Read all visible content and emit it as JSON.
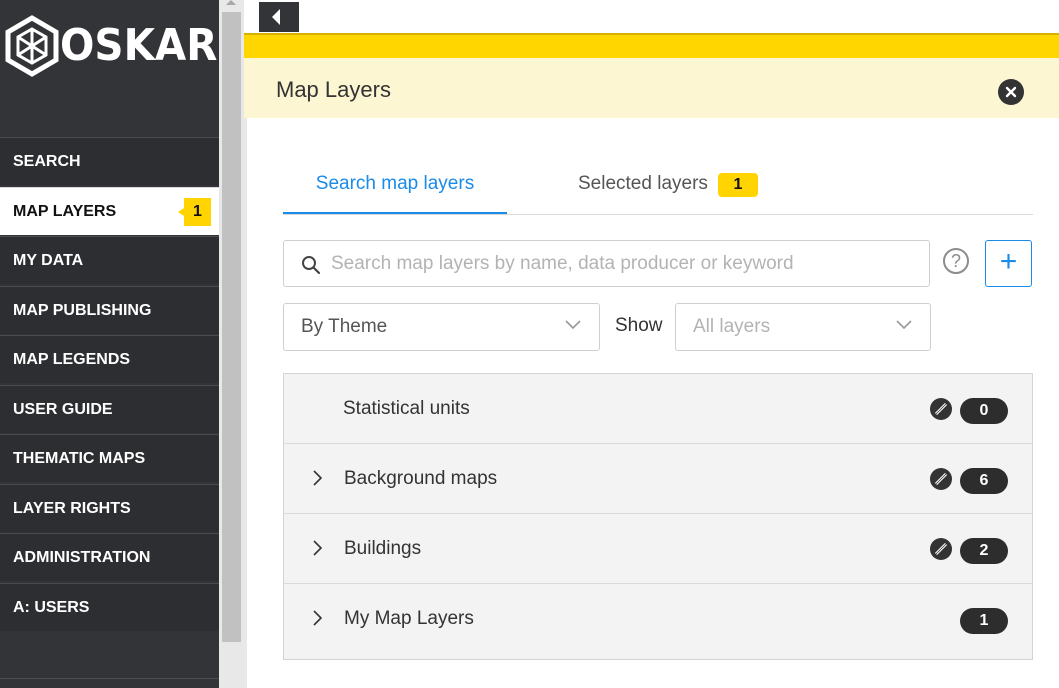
{
  "app": {
    "logo_text": "OSKARI"
  },
  "sidebar": {
    "items": [
      {
        "label": "SEARCH"
      },
      {
        "label": "MAP LAYERS",
        "badge": "1",
        "active": true
      },
      {
        "label": "MY DATA"
      },
      {
        "label": "MAP PUBLISHING"
      },
      {
        "label": "MAP LEGENDS"
      },
      {
        "label": "USER GUIDE"
      },
      {
        "label": "THEMATIC MAPS"
      },
      {
        "label": "LAYER RIGHTS"
      },
      {
        "label": "ADMINISTRATION"
      },
      {
        "label": "A: USERS"
      }
    ]
  },
  "flyout": {
    "title": "Map Layers",
    "tabs": [
      {
        "label": "Search map layers",
        "active": true
      },
      {
        "label": "Selected layers",
        "badge": "1"
      }
    ],
    "search": {
      "placeholder": "Search map layers by name, data producer or keyword",
      "value": ""
    },
    "help_label": "?",
    "add_label": "+",
    "grouping_select": {
      "value": "By Theme"
    },
    "show_label": "Show",
    "show_select": {
      "value": "All layers"
    },
    "groups": [
      {
        "name": "Statistical units",
        "count": "0",
        "editable": true,
        "expandable": false
      },
      {
        "name": "Background maps",
        "count": "6",
        "editable": true,
        "expandable": true
      },
      {
        "name": "Buildings",
        "count": "2",
        "editable": true,
        "expandable": true
      },
      {
        "name": "My Map Layers",
        "count": "1",
        "editable": false,
        "expandable": true
      }
    ]
  },
  "colors": {
    "accent_blue": "#1a8be8",
    "highlight_yellow": "#ffd400",
    "sidebar_bg": "#333438",
    "header_bg": "#fdf6d3"
  }
}
